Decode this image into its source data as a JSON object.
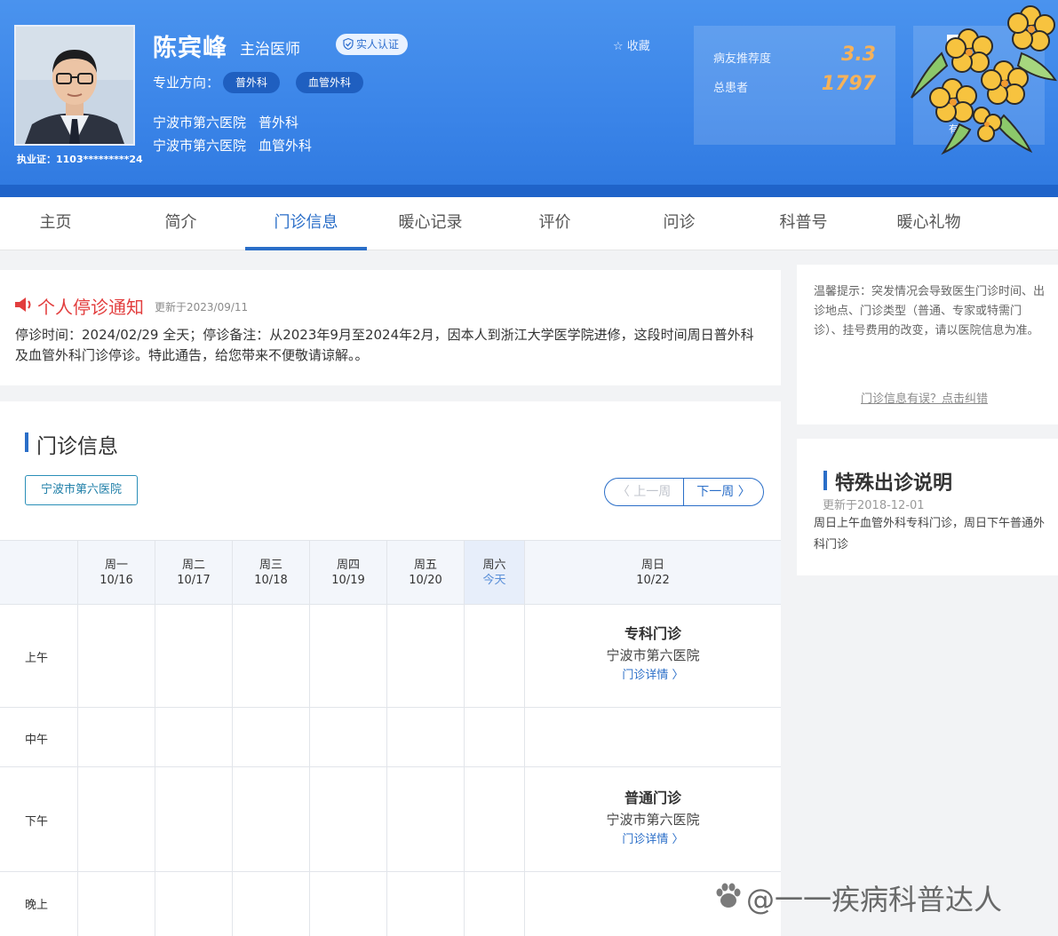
{
  "doctor": {
    "name": "陈宾峰",
    "title": "主治医师",
    "verified_label": "实人认证",
    "license": "执业证：1103*********24",
    "specialty_label": "专业方向：",
    "specialty_tags": [
      "普外科",
      "血管外科"
    ],
    "affiliations": [
      {
        "hospital": "宁波市第六医院",
        "dept": "普外科"
      },
      {
        "hospital": "宁波市第六医院",
        "dept": "血管外科"
      }
    ],
    "favorite_label": "☆ 收藏"
  },
  "stats": {
    "recommend_label": "病友推荐度",
    "recommend_value": "3.3",
    "patients_label": "总患者",
    "patients_value": "1797"
  },
  "gift_partial_text": "有",
  "nav": {
    "items": [
      "主页",
      "简介",
      "门诊信息",
      "暖心记录",
      "评价",
      "问诊",
      "科普号",
      "暖心礼物"
    ],
    "active_index": 2
  },
  "notice": {
    "title": "个人停诊通知",
    "updated": "更新于2023/09/11",
    "body": "停诊时间：2024/02/29 全天；停诊备注：从2023年9月至2024年2月，因本人到浙江大学医学院进修，这段时间周日普外科及血管外科门诊停诊。特此通告，给您带来不便敬请谅解。。"
  },
  "tips": {
    "text": "温馨提示：突发情况会导致医生门诊时间、出诊地点、门诊类型（普通、专家或特需门诊）、挂号费用的改变，请以医院信息为准。",
    "link": "门诊信息有误？点击纠错"
  },
  "special": {
    "title": "特殊出诊说明",
    "updated": "更新于2018-12-01",
    "body": "周日上午血管外科专科门诊，周日下午普通外科门诊"
  },
  "clinic": {
    "title": "门诊信息",
    "hospital_button": "宁波市第六医院",
    "prev_week": "〈 上一周",
    "next_week": "下一周 〉",
    "days": [
      {
        "weekday": "周一",
        "date": "10/16"
      },
      {
        "weekday": "周二",
        "date": "10/17"
      },
      {
        "weekday": "周三",
        "date": "10/18"
      },
      {
        "weekday": "周四",
        "date": "10/19"
      },
      {
        "weekday": "周五",
        "date": "10/20"
      },
      {
        "weekday": "周六",
        "date": "今天"
      },
      {
        "weekday": "周日",
        "date": "10/22"
      }
    ],
    "slots": [
      "上午",
      "中午",
      "下午",
      "晚上"
    ],
    "schedule": [
      {
        "slot": "上午",
        "type": "专科门诊",
        "hospital": "宁波市第六医院",
        "detail": "门诊详情 〉"
      },
      {
        "slot": "下午",
        "type": "普通门诊",
        "hospital": "宁波市第六医院",
        "detail": "门诊详情 〉"
      }
    ]
  },
  "watermark": "@一一疾病科普达人",
  "colors": {
    "header_blue": "#3a84e8",
    "accent_blue": "#2a6ec8",
    "notice_red": "#e23e3e",
    "stat_orange": "#f6b25a"
  }
}
